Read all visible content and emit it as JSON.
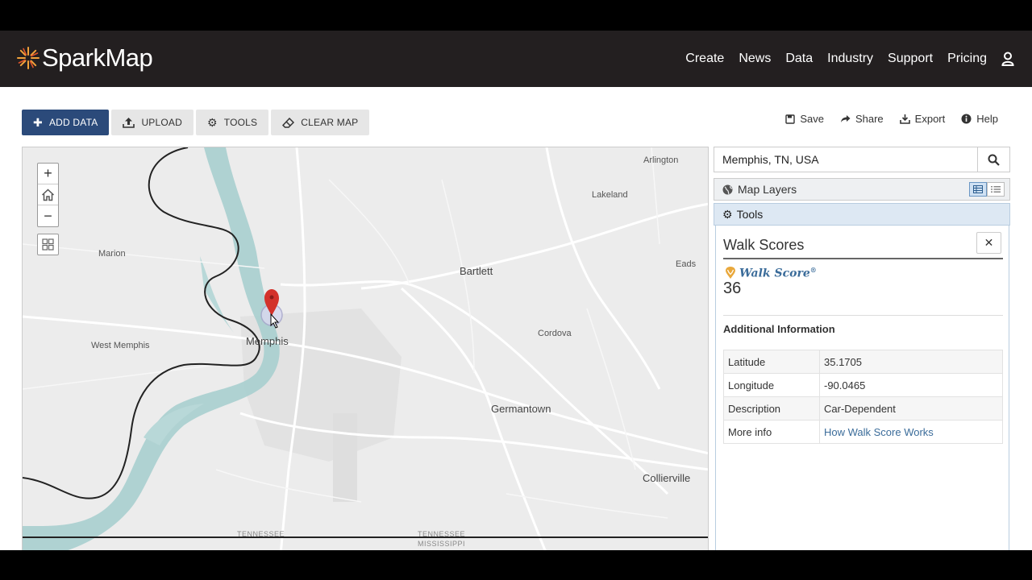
{
  "app": {
    "logo_text": "SparkMap"
  },
  "nav": {
    "items": [
      "Create",
      "News",
      "Data",
      "Industry",
      "Support",
      "Pricing"
    ],
    "user_icon": "user-icon"
  },
  "toolbar": {
    "add_data": "Add Data",
    "upload": "Upload",
    "tools": "Tools",
    "clear_map": "Clear Map"
  },
  "actions": {
    "save": "Save",
    "share": "Share",
    "export": "Export",
    "help": "Help"
  },
  "map": {
    "labels": {
      "arlington": "Arlington",
      "lakeland": "Lakeland",
      "marion": "Marion",
      "bartlett": "Bartlett",
      "eads": "Eads",
      "cordova": "Cordova",
      "west_memphis": "West Memphis",
      "memphis": "Memphis",
      "germantown": "Germantown",
      "collierville": "Collierville",
      "tennessee_1": "TENNESSEE",
      "tennessee_2": "TENNESSEE",
      "mississippi": "MISSISSIPPI"
    },
    "zoom_in": "+",
    "zoom_out": "−"
  },
  "search": {
    "value": "Memphis, TN, USA"
  },
  "panels": {
    "map_layers": "Map Layers",
    "tools": "Tools"
  },
  "walkscore": {
    "title": "Walk Scores",
    "brand": "Walk Score",
    "brand_mark": "®",
    "score": "36",
    "additional_title": "Additional Information",
    "rows": [
      {
        "key": "Latitude",
        "value": "35.1705"
      },
      {
        "key": "Longitude",
        "value": "-90.0465"
      },
      {
        "key": "Description",
        "value": "Car-Dependent"
      },
      {
        "key": "More info",
        "value": "How Walk Score Works"
      }
    ]
  },
  "colors": {
    "header_bg": "#231f20",
    "primary_button": "#2b4a7a",
    "river": "#a9cfcf",
    "pin": "#d3322b",
    "link": "#3b6c9a"
  }
}
